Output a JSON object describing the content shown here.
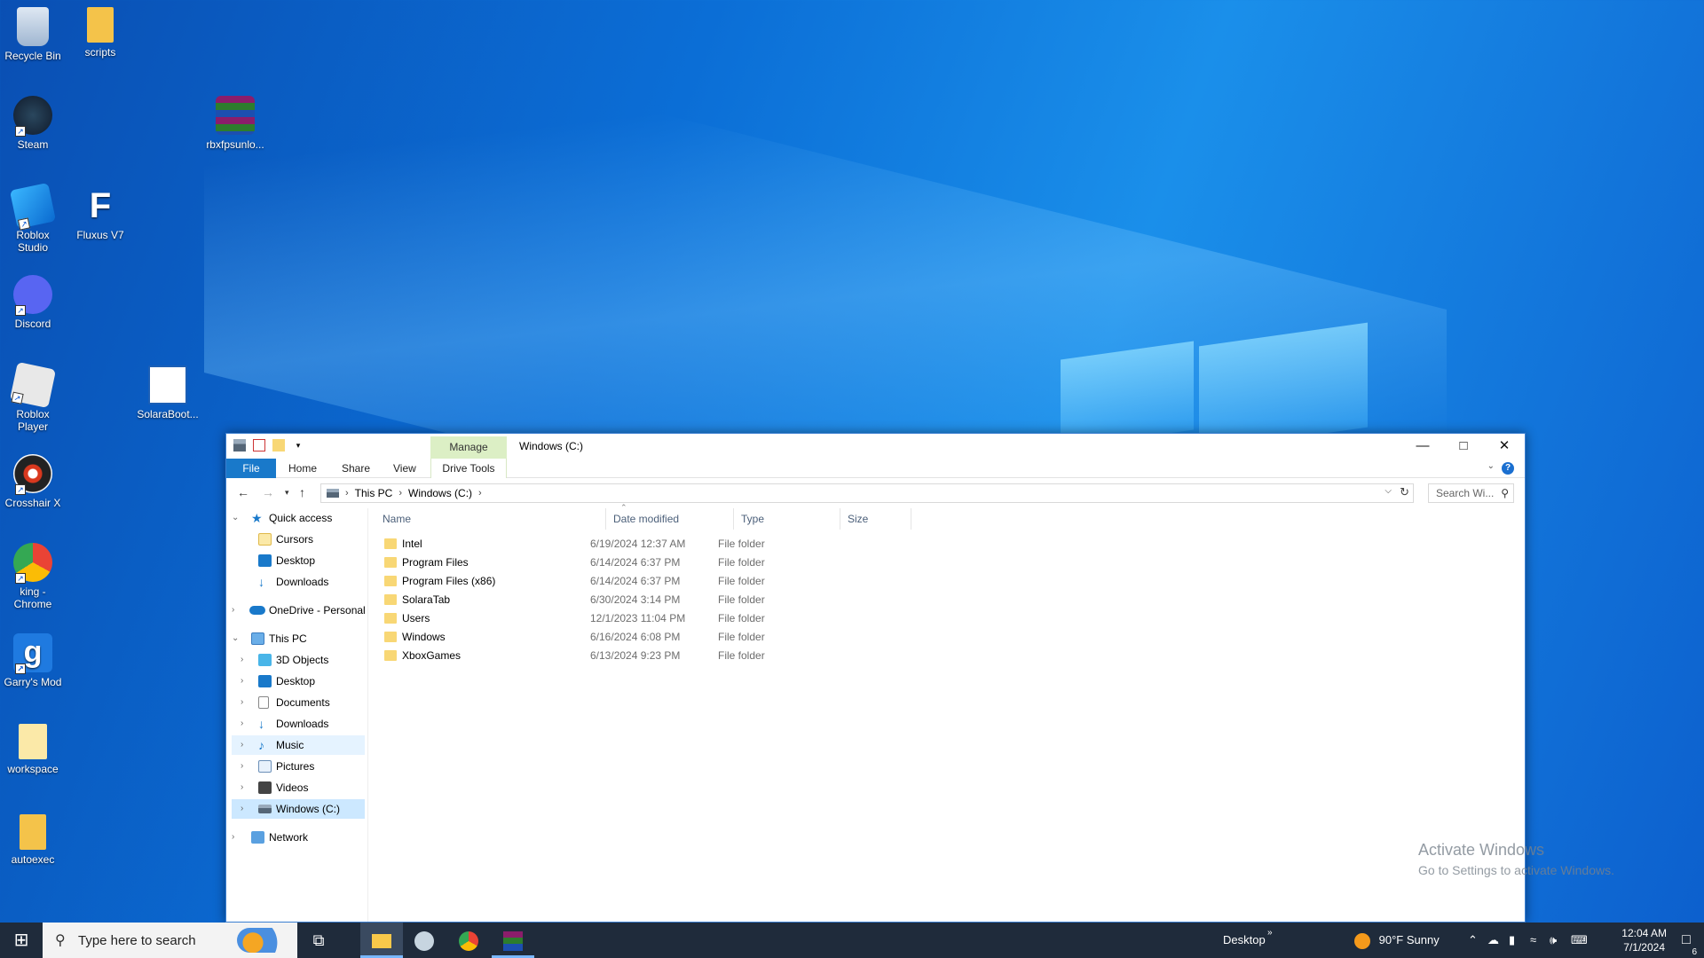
{
  "desktop": {
    "icons": [
      {
        "label": "Recycle Bin"
      },
      {
        "label": "scripts"
      },
      {
        "label": "Steam"
      },
      {
        "label": "rbxfpsunlo..."
      },
      {
        "label": "Roblox Studio"
      },
      {
        "label": "Fluxus V7"
      },
      {
        "label": "Discord"
      },
      {
        "label": "Roblox Player"
      },
      {
        "label": "SolaraBoot..."
      },
      {
        "label": "Crosshair X"
      },
      {
        "label": "king - Chrome"
      },
      {
        "label": "Garry's Mod"
      },
      {
        "label": "workspace"
      },
      {
        "label": "autoexec"
      }
    ]
  },
  "explorer": {
    "title": "Windows (C:)",
    "manage_tab": "Manage",
    "ribbon_tabs": {
      "file": "File",
      "home": "Home",
      "share": "Share",
      "view": "View",
      "drive_tools": "Drive Tools"
    },
    "help": "?",
    "breadcrumb": {
      "root": "This PC",
      "current": "Windows (C:)"
    },
    "search_placeholder": "Search Wi...",
    "nav": {
      "quick_access": "Quick access",
      "quick_items": [
        "Cursors",
        "Desktop",
        "Downloads"
      ],
      "onedrive": "OneDrive - Personal",
      "this_pc": "This PC",
      "pc_items": [
        "3D Objects",
        "Desktop",
        "Documents",
        "Downloads",
        "Music",
        "Pictures",
        "Videos",
        "Windows (C:)"
      ],
      "network": "Network"
    },
    "columns": {
      "name": "Name",
      "date": "Date modified",
      "type": "Type",
      "size": "Size"
    },
    "files": [
      {
        "name": "Intel",
        "date": "6/19/2024 12:37 AM",
        "type": "File folder"
      },
      {
        "name": "Program Files",
        "date": "6/14/2024 6:37 PM",
        "type": "File folder"
      },
      {
        "name": "Program Files (x86)",
        "date": "6/14/2024 6:37 PM",
        "type": "File folder"
      },
      {
        "name": "SolaraTab",
        "date": "6/30/2024 3:14 PM",
        "type": "File folder"
      },
      {
        "name": "Users",
        "date": "12/1/2023 11:04 PM",
        "type": "File folder"
      },
      {
        "name": "Windows",
        "date": "6/16/2024 6:08 PM",
        "type": "File folder"
      },
      {
        "name": "XboxGames",
        "date": "6/13/2024 9:23 PM",
        "type": "File folder"
      }
    ]
  },
  "watermark": {
    "line1": "Activate Windows",
    "line2": "Go to Settings to activate Windows."
  },
  "taskbar": {
    "search_placeholder": "Type here to search",
    "desktop_label": "Desktop",
    "weather": "90°F  Sunny",
    "time": "12:04 AM",
    "date": "7/1/2024",
    "notification_count": "6"
  },
  "colors": {
    "accent": "#1979ca",
    "selection": "#cce8ff",
    "taskbar": "#1f2b3b",
    "folder": "#f8d775"
  }
}
